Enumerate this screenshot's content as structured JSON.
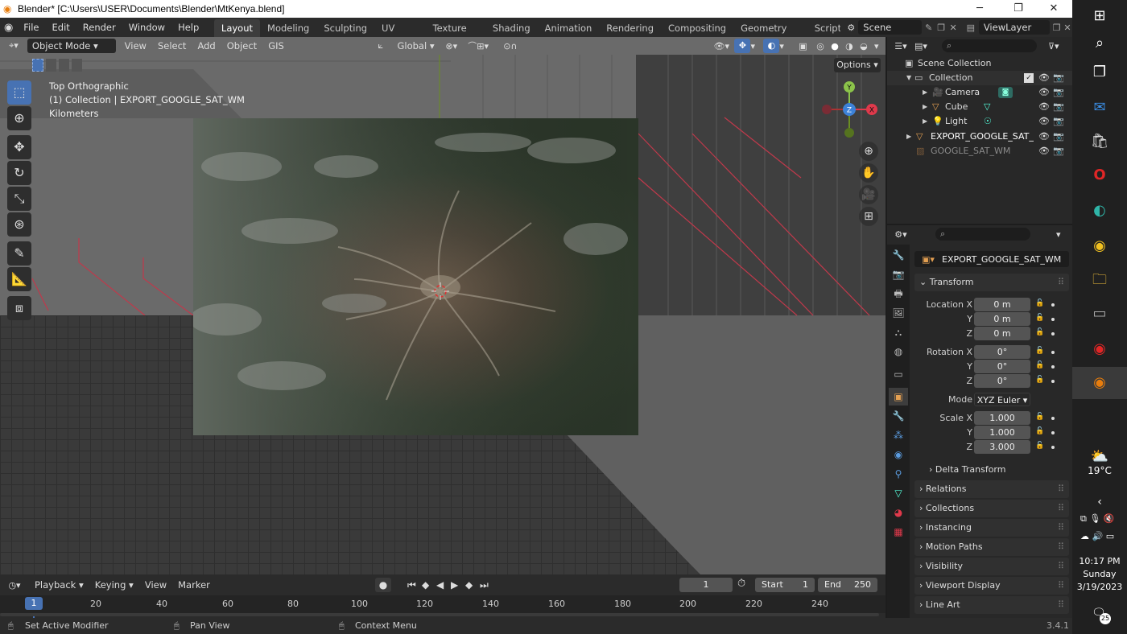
{
  "window": {
    "title": "Blender* [C:\\Users\\USER\\Documents\\Blender\\MtKenya.blend]",
    "minimize": "─",
    "maximize": "❐",
    "close": "✕"
  },
  "menu": [
    "File",
    "Edit",
    "Render",
    "Window",
    "Help"
  ],
  "workspaces": [
    "Layout",
    "Modeling",
    "Sculpting",
    "UV Editing",
    "Texture Paint",
    "Shading",
    "Animation",
    "Rendering",
    "Compositing",
    "Geometry Nodes",
    "Scripting"
  ],
  "scene": "Scene",
  "viewlayer": "ViewLayer",
  "viewport": {
    "mode": "Object Mode",
    "menus": [
      "View",
      "Select",
      "Add",
      "Object",
      "GIS"
    ],
    "transform": "Global",
    "options": "Options",
    "overlay": [
      "Top Orthographic",
      "(1) Collection | EXPORT_GOOGLE_SAT_WM",
      "Kilometers"
    ],
    "gizmo": {
      "y": "Y",
      "z": "Z",
      "x": "X"
    }
  },
  "outliner": {
    "title": "Scene Collection",
    "items": [
      {
        "name": "Collection"
      },
      {
        "name": "Camera"
      },
      {
        "name": "Cube"
      },
      {
        "name": "Light"
      },
      {
        "name": "EXPORT_GOOGLE_SAT_"
      },
      {
        "name": "GOOGLE_SAT_WM"
      }
    ]
  },
  "properties": {
    "object": "EXPORT_GOOGLE_SAT_WM",
    "transform": "Transform",
    "location_label": "Location X",
    "rotation_label": "Rotation X",
    "scale_label": "Scale X",
    "y": "Y",
    "z": "Z",
    "location": [
      "0 m",
      "0 m",
      "0 m"
    ],
    "rotation": [
      "0°",
      "0°",
      "0°"
    ],
    "mode_label": "Mode",
    "mode": "XYZ Euler",
    "scale": [
      "1.000",
      "1.000",
      "3.000"
    ],
    "delta": "Delta Transform",
    "panels": [
      "Relations",
      "Collections",
      "Instancing",
      "Motion Paths",
      "Visibility",
      "Viewport Display",
      "Line Art"
    ]
  },
  "timeline": {
    "menus": [
      "Playback",
      "Keying",
      "View",
      "Marker"
    ],
    "current": "1",
    "start_label": "Start",
    "start": "1",
    "end_label": "End",
    "end": "250",
    "ticks": [
      "1",
      "20",
      "40",
      "60",
      "80",
      "100",
      "120",
      "140",
      "160",
      "180",
      "200",
      "220",
      "240"
    ]
  },
  "status": {
    "left": "Set Active Modifier",
    "mid": "Pan View",
    "right": "Context Menu",
    "version": "3.4.1"
  },
  "taskbar": {
    "temp": "19°C",
    "time": "10:17 PM",
    "day": "Sunday",
    "date": "3/19/2023",
    "notif": "25"
  }
}
